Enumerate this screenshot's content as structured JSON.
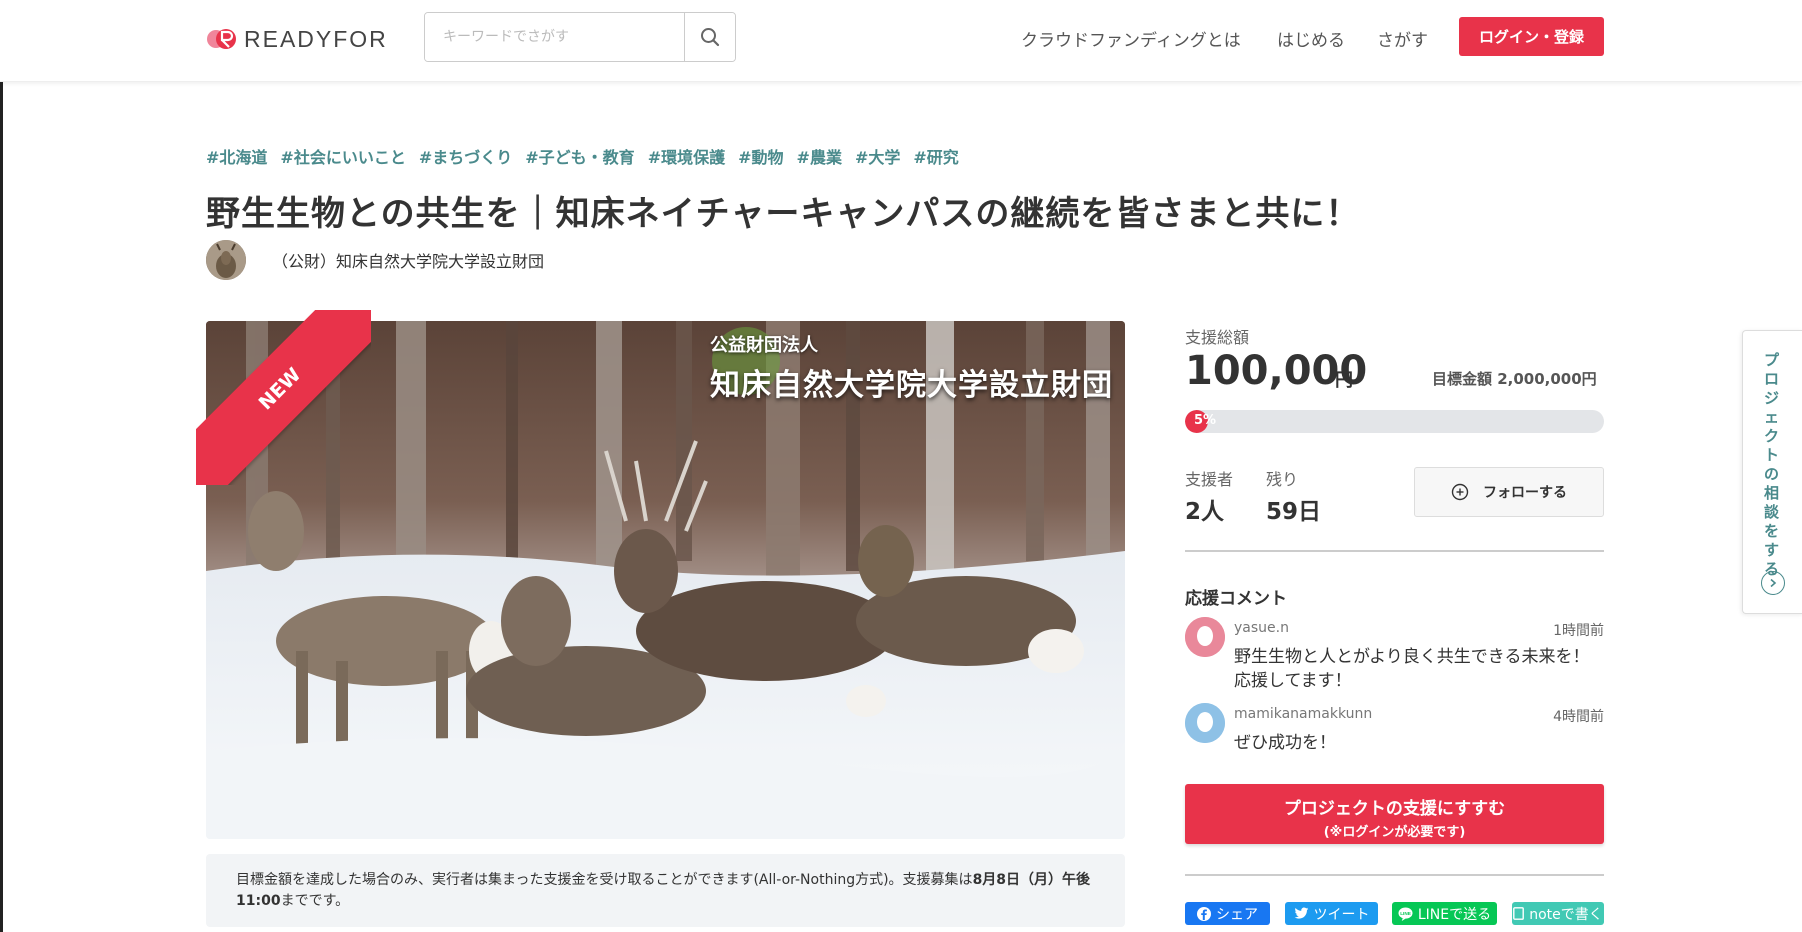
{
  "header": {
    "logo_text": "READYFOR",
    "search_placeholder": "キーワードでさがす",
    "nav": [
      "クラウドファンディングとは",
      "はじめる",
      "さがす"
    ],
    "login_label": "ログイン・登録"
  },
  "project": {
    "tags": [
      "#北海道",
      "#社会にいいこと",
      "#まちづくり",
      "#子ども・教育",
      "#環境保護",
      "#動物",
      "#農業",
      "#大学",
      "#研究"
    ],
    "title": "野生生物との共生を｜知床ネイチャーキャンパスの継続を皆さまと共に！",
    "owner": "（公財）知床自然大学院大学設立財団",
    "ribbon": "NEW",
    "image_caption_small": "公益財団法人",
    "image_caption_large": "知床自然大学院大学設立財団",
    "notice_text": "目標金額を達成した場合のみ、実行者は集まった支援金を受け取ることができます(All-or-Nothing方式)。支援募集は",
    "notice_bold": "8月8日（月）午後11:00",
    "notice_tail": "までです。"
  },
  "stats": {
    "total_label": "支援総額",
    "total_amount": "100,000",
    "currency": "円",
    "goal_text": "目標金額 2,000,000円",
    "progress_percent": 5,
    "progress_label": "5%",
    "supporters_label": "支援者",
    "supporters_value": "2人",
    "remaining_label": "残り",
    "remaining_value": "59日",
    "follow_label": "フォローする"
  },
  "comments": {
    "title": "応援コメント",
    "items": [
      {
        "user": "yasue.n",
        "time": "1時間前",
        "body_line1": "野生生物と人とがより良く共生できる未来を！",
        "body_line2": "応援してます！",
        "avatar_color": "#e9889a"
      },
      {
        "user": "mamikanamakkunn",
        "time": "4時間前",
        "body_line1": "ぜひ成功を！",
        "body_line2": "",
        "avatar_color": "#8ec1e6"
      }
    ]
  },
  "support_button": {
    "line1": "プロジェクトの支援にすすむ",
    "line2": "(※ログインが必要です)"
  },
  "share": {
    "facebook": "シェア",
    "twitter": "ツイート",
    "line": "LINEで送る",
    "note": "noteで書く"
  },
  "side_tab": {
    "label": "プロジェクトの相談をする"
  },
  "colors": {
    "brand_red": "#e8334a",
    "tag_teal": "#4a8a8c"
  }
}
